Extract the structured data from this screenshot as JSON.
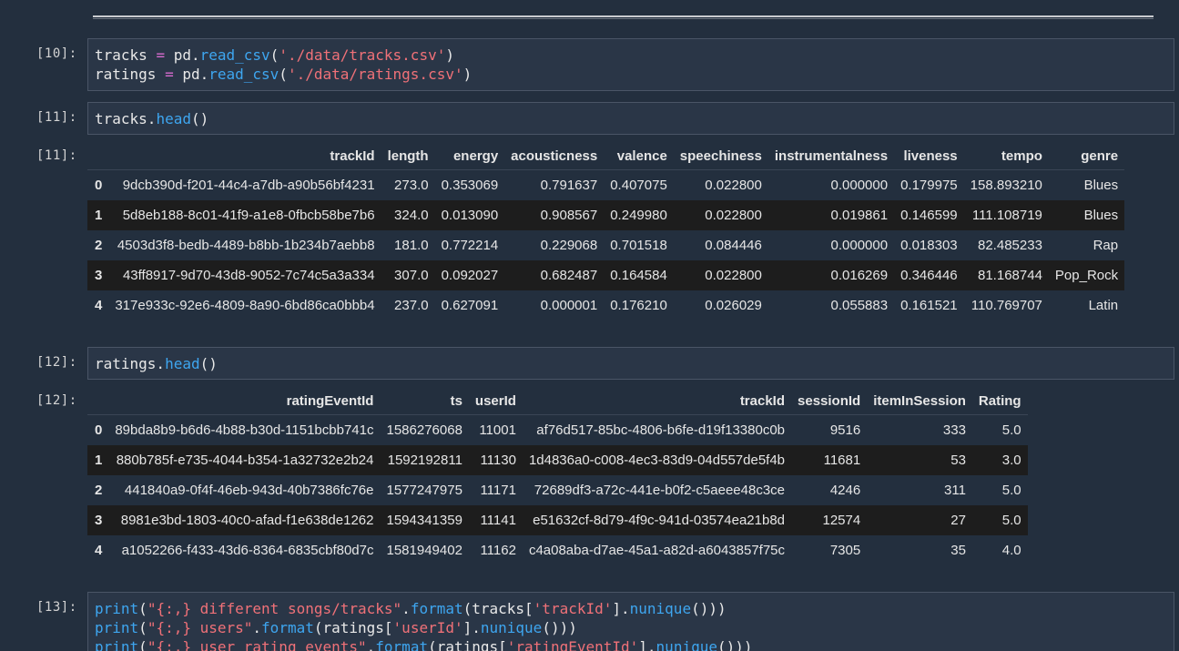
{
  "cells": [
    {
      "prompt": "[10]:",
      "lines": [
        [
          {
            "t": "tracks ",
            "c": "plain"
          },
          {
            "t": "=",
            "c": "op"
          },
          {
            "t": " pd.",
            "c": "plain"
          },
          {
            "t": "read_csv",
            "c": "fn"
          },
          {
            "t": "(",
            "c": "plain"
          },
          {
            "t": "'./data/tracks.csv'",
            "c": "str"
          },
          {
            "t": ")",
            "c": "plain"
          }
        ],
        [
          {
            "t": "ratings ",
            "c": "plain"
          },
          {
            "t": "=",
            "c": "op"
          },
          {
            "t": " pd.",
            "c": "plain"
          },
          {
            "t": "read_csv",
            "c": "fn"
          },
          {
            "t": "(",
            "c": "plain"
          },
          {
            "t": "'./data/ratings.csv'",
            "c": "str"
          },
          {
            "t": ")",
            "c": "plain"
          }
        ]
      ]
    },
    {
      "prompt": "[11]:",
      "lines": [
        [
          {
            "t": "tracks.",
            "c": "plain"
          },
          {
            "t": "head",
            "c": "fn"
          },
          {
            "t": "()",
            "c": "plain"
          }
        ]
      ]
    },
    {
      "prompt": "[12]:",
      "lines": [
        [
          {
            "t": "ratings.",
            "c": "plain"
          },
          {
            "t": "head",
            "c": "fn"
          },
          {
            "t": "()",
            "c": "plain"
          }
        ]
      ]
    },
    {
      "prompt": "[13]:",
      "lines": [
        [
          {
            "t": "print",
            "c": "fn"
          },
          {
            "t": "(",
            "c": "plain"
          },
          {
            "t": "\"{:,} different songs/tracks\"",
            "c": "str"
          },
          {
            "t": ".",
            "c": "plain"
          },
          {
            "t": "format",
            "c": "fn"
          },
          {
            "t": "(tracks[",
            "c": "plain"
          },
          {
            "t": "'trackId'",
            "c": "str"
          },
          {
            "t": "].",
            "c": "plain"
          },
          {
            "t": "nunique",
            "c": "fn"
          },
          {
            "t": "()))",
            "c": "plain"
          }
        ],
        [
          {
            "t": "print",
            "c": "fn"
          },
          {
            "t": "(",
            "c": "plain"
          },
          {
            "t": "\"{:,} users\"",
            "c": "str"
          },
          {
            "t": ".",
            "c": "plain"
          },
          {
            "t": "format",
            "c": "fn"
          },
          {
            "t": "(ratings[",
            "c": "plain"
          },
          {
            "t": "'userId'",
            "c": "str"
          },
          {
            "t": "].",
            "c": "plain"
          },
          {
            "t": "nunique",
            "c": "fn"
          },
          {
            "t": "()))",
            "c": "plain"
          }
        ],
        [
          {
            "t": "print",
            "c": "fn"
          },
          {
            "t": "(",
            "c": "plain"
          },
          {
            "t": "\"{:,} user rating events\"",
            "c": "str"
          },
          {
            "t": ".",
            "c": "plain"
          },
          {
            "t": "format",
            "c": "fn"
          },
          {
            "t": "(ratings[",
            "c": "plain"
          },
          {
            "t": "'ratingEventId'",
            "c": "str"
          },
          {
            "t": "].",
            "c": "plain"
          },
          {
            "t": "nunique",
            "c": "fn"
          },
          {
            "t": "()))",
            "c": "plain"
          }
        ]
      ]
    }
  ],
  "outputs": [
    {
      "prompt": "[11]:",
      "columns": [
        "",
        "trackId",
        "length",
        "energy",
        "acousticness",
        "valence",
        "speechiness",
        "instrumentalness",
        "liveness",
        "tempo",
        "genre"
      ],
      "rows": [
        [
          "0",
          "9dcb390d-f201-44c4-a7db-a90b56bf4231",
          "273.0",
          "0.353069",
          "0.791637",
          "0.407075",
          "0.022800",
          "0.000000",
          "0.179975",
          "158.893210",
          "Blues"
        ],
        [
          "1",
          "5d8eb188-8c01-41f9-a1e8-0fbcb58be7b6",
          "324.0",
          "0.013090",
          "0.908567",
          "0.249980",
          "0.022800",
          "0.019861",
          "0.146599",
          "111.108719",
          "Blues"
        ],
        [
          "2",
          "4503d3f8-bedb-4489-b8bb-1b234b7aebb8",
          "181.0",
          "0.772214",
          "0.229068",
          "0.701518",
          "0.084446",
          "0.000000",
          "0.018303",
          "82.485233",
          "Rap"
        ],
        [
          "3",
          "43ff8917-9d70-43d8-9052-7c74c5a3a334",
          "307.0",
          "0.092027",
          "0.682487",
          "0.164584",
          "0.022800",
          "0.016269",
          "0.346446",
          "81.168744",
          "Pop_Rock"
        ],
        [
          "4",
          "317e933c-92e6-4809-8a90-6bd86ca0bbb4",
          "237.0",
          "0.627091",
          "0.000001",
          "0.176210",
          "0.026029",
          "0.055883",
          "0.161521",
          "110.769707",
          "Latin"
        ]
      ]
    },
    {
      "prompt": "[12]:",
      "columns": [
        "",
        "ratingEventId",
        "ts",
        "userId",
        "trackId",
        "sessionId",
        "itemInSession",
        "Rating"
      ],
      "rows": [
        [
          "0",
          "89bda8b9-b6d6-4b88-b30d-1151bcbb741c",
          "1586276068",
          "11001",
          "af76d517-85bc-4806-b6fe-d19f13380c0b",
          "9516",
          "333",
          "5.0"
        ],
        [
          "1",
          "880b785f-e735-4044-b354-1a32732e2b24",
          "1592192811",
          "11130",
          "1d4836a0-c008-4ec3-83d9-04d557de5f4b",
          "11681",
          "53",
          "3.0"
        ],
        [
          "2",
          "441840a9-0f4f-46eb-943d-40b7386fc76e",
          "1577247975",
          "11171",
          "72689df3-a72c-441e-b0f2-c5aeee48c3ce",
          "4246",
          "311",
          "5.0"
        ],
        [
          "3",
          "8981e3bd-1803-40c0-afad-f1e638de1262",
          "1594341359",
          "11141",
          "e51632cf-8d79-4f9c-941d-03574ea21b8d",
          "12574",
          "27",
          "5.0"
        ],
        [
          "4",
          "a1052266-f433-43d6-8364-6835cbf80d7c",
          "1581949402",
          "11162",
          "c4a08aba-d7ae-45a1-a82d-a6043857f75c",
          "7305",
          "35",
          "4.0"
        ]
      ]
    }
  ]
}
